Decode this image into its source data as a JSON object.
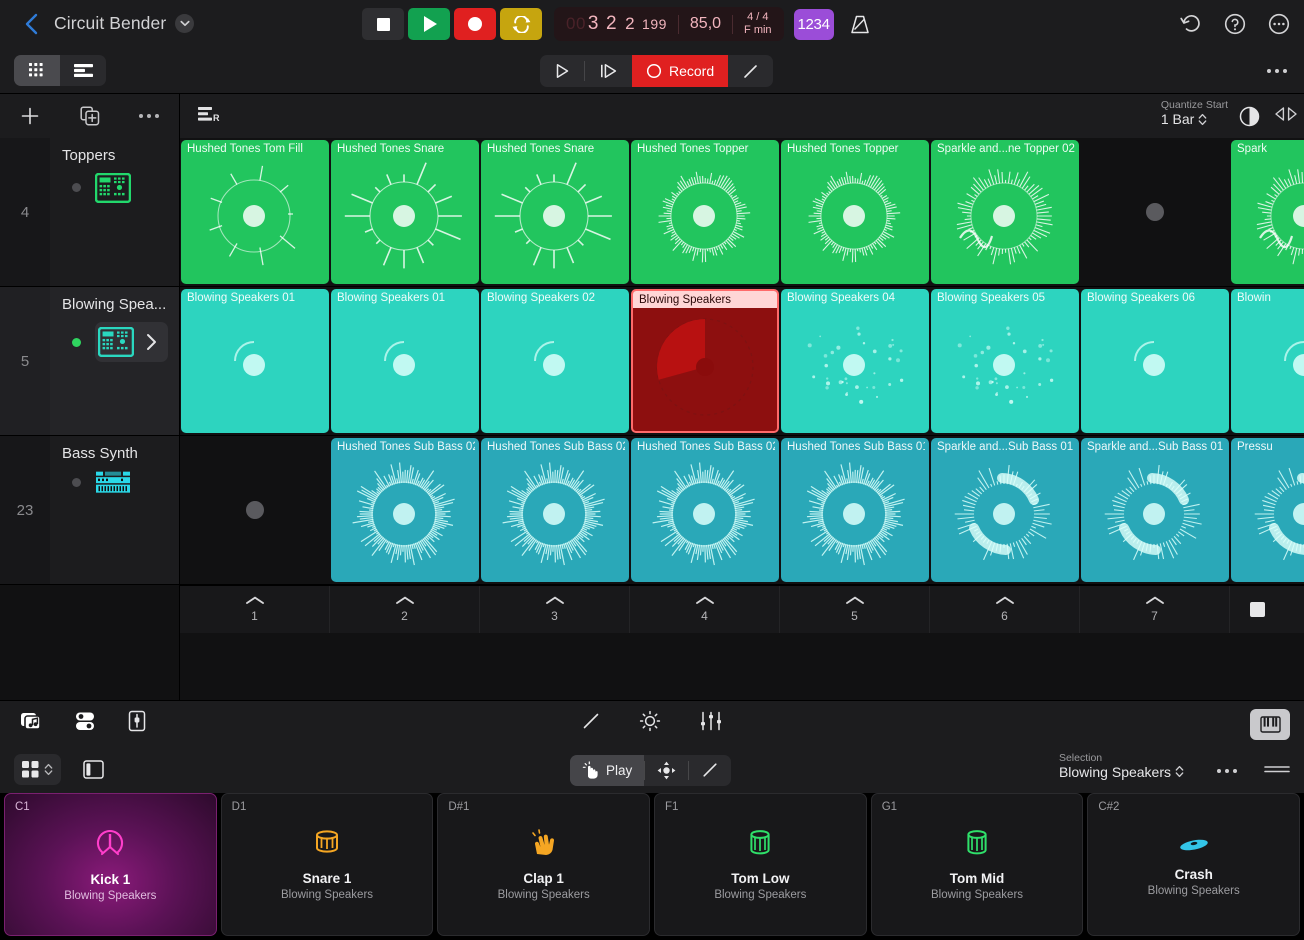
{
  "topbar": {
    "back_icon": "chevron-left-icon",
    "project_title": "Circuit Bender",
    "title_chevron_icon": "chevron-down-icon",
    "transport": {
      "stop_label": "stop",
      "play_label": "play",
      "record_label": "record",
      "cycle_label": "cycle"
    },
    "lcd": {
      "position_dim": "00",
      "bar": "3",
      "beat": "2",
      "division": "2",
      "ticks": "199",
      "tempo": "85,0",
      "time_signature": "4 / 4",
      "key": "F min"
    },
    "count_in_label": "1234",
    "metronome_icon": "metronome-icon",
    "undo_icon": "undo-icon",
    "help_icon": "help-icon",
    "more_icon": "more-icon"
  },
  "bar2": {
    "view_grid_icon": "grid-view-icon",
    "view_tracks_icon": "tracks-view-icon",
    "play_icon": "play-outline-icon",
    "play_from_icon": "play-from-start-icon",
    "record_label": "Record",
    "pencil_icon": "pencil-icon",
    "more_icon": "more-icon"
  },
  "track_toolbar": {
    "add_icon": "plus-icon",
    "duplicate_icon": "duplicate-icon",
    "more_icon": "more-icon",
    "mixer_icon": "mixer-r-icon",
    "quantize_label": "Quantize Start",
    "quantize_value": "1 Bar",
    "quantize_chevron_icon": "chevron-updown-icon",
    "pie_icon": "quantize-pie-icon",
    "arrows_icon": "play-stop-arrows-icon"
  },
  "tracks": [
    {
      "number": "4",
      "name": "Toppers",
      "instrument_icon": "drum-machine-icon",
      "icon_color": "#22d86c",
      "record_enabled": false,
      "selected": false,
      "has_chevron": false,
      "row_end": "play-stop-arrows-icon",
      "color": "#22c55e",
      "cells": [
        {
          "label": "Hushed Tones Tom Fill",
          "state": "clip",
          "art": "tomfill"
        },
        {
          "label": "Hushed Tones Snare",
          "state": "clip",
          "art": "snare"
        },
        {
          "label": "Hushed Tones Snare",
          "state": "clip",
          "art": "snare"
        },
        {
          "label": "Hushed Tones Topper",
          "state": "clip",
          "art": "topper"
        },
        {
          "label": "Hushed Tones Topper",
          "state": "clip",
          "art": "topper"
        },
        {
          "label": "Sparkle and...ne Topper 02",
          "state": "clip",
          "art": "sparkle"
        },
        {
          "label": "",
          "state": "empty",
          "art": ""
        },
        {
          "label": "Spark",
          "state": "clip-partial",
          "art": "sparkle"
        }
      ]
    },
    {
      "number": "5",
      "name": "Blowing Spea...",
      "instrument_icon": "drum-machine-icon",
      "icon_color": "#2ad8c0",
      "record_enabled": true,
      "selected": true,
      "has_chevron": true,
      "chevron_icon": "chevron-right-icon",
      "row_end": "stop-square",
      "color": "#2dd4bf",
      "cells": [
        {
          "label": "Blowing Speakers 01",
          "state": "clip",
          "art": "ring-small"
        },
        {
          "label": "Blowing Speakers 01",
          "state": "clip",
          "art": "ring-small"
        },
        {
          "label": "Blowing Speakers 02",
          "state": "clip",
          "art": "ring-small"
        },
        {
          "label": "Blowing Speakers",
          "state": "recording",
          "art": "recording-pie"
        },
        {
          "label": "Blowing Speakers 04",
          "state": "clip",
          "art": "sparse"
        },
        {
          "label": "Blowing Speakers 05",
          "state": "clip",
          "art": "sparse"
        },
        {
          "label": "Blowing Speakers 06",
          "state": "clip",
          "art": "ring-small"
        },
        {
          "label": "Blowin",
          "state": "clip-partial",
          "art": "ring-small"
        }
      ]
    },
    {
      "number": "23",
      "name": "Bass Synth",
      "instrument_icon": "synth-icon",
      "icon_color": "#2ad8e8",
      "record_enabled": false,
      "selected": false,
      "has_chevron": false,
      "row_end": "play-stop-arrows-icon",
      "color": "#2aa8b8",
      "cells": [
        {
          "label": "",
          "state": "empty",
          "art": ""
        },
        {
          "label": "Hushed Tones Sub Bass 02",
          "state": "clip",
          "art": "bass-ring"
        },
        {
          "label": "Hushed Tones Sub Bass 02",
          "state": "clip",
          "art": "bass-ring"
        },
        {
          "label": "Hushed Tones Sub Bass 02",
          "state": "clip",
          "art": "bass-ring"
        },
        {
          "label": "Hushed Tones Sub Bass 01",
          "state": "clip",
          "art": "bass-ring"
        },
        {
          "label": "Sparkle and...Sub Bass 01",
          "state": "clip",
          "art": "bass-swirl"
        },
        {
          "label": "Sparkle and...Sub Bass 01",
          "state": "clip",
          "art": "bass-swirl"
        },
        {
          "label": "Pressu",
          "state": "clip-partial",
          "art": "bass-swirl"
        }
      ]
    }
  ],
  "scenes": [
    {
      "num": "1"
    },
    {
      "num": "2"
    },
    {
      "num": "3"
    },
    {
      "num": "4"
    },
    {
      "num": "5"
    },
    {
      "num": "6"
    },
    {
      "num": "7"
    }
  ],
  "editor_bar": {
    "loops_icon": "loop-browser-icon",
    "toggles_icon": "sound-settings-icon",
    "plugin_icon": "plugin-icon",
    "pencil_icon": "pencil-icon",
    "brightness_icon": "brightness-icon",
    "faders_icon": "faders-icon",
    "keyboard_icon": "keyboard-icon"
  },
  "selection_bar": {
    "grid_icon": "pad-grid-icon",
    "grid_chevron_icon": "chevron-updown-icon",
    "panel_icon": "side-panel-icon",
    "play_label": "Play",
    "play_icon": "tap-hand-icon",
    "move_icon": "move-icon",
    "pencil_icon": "pencil-icon",
    "selection_label": "Selection",
    "selection_value": "Blowing Speakers",
    "selection_chevron_icon": "chevron-updown-icon",
    "more_icon": "more-icon",
    "handle_icon": "drag-handle-icon"
  },
  "pads": [
    {
      "note": "C1",
      "name": "Kick 1",
      "sub": "Blowing Speakers",
      "glyph": "kick",
      "color": "#ff3ecb",
      "active": true
    },
    {
      "note": "D1",
      "name": "Snare 1",
      "sub": "Blowing Speakers",
      "glyph": "snare",
      "color": "#f5a623",
      "active": false
    },
    {
      "note": "D#1",
      "name": "Clap 1",
      "sub": "Blowing Speakers",
      "glyph": "clap",
      "color": "#f5a623",
      "active": false
    },
    {
      "note": "F1",
      "name": "Tom Low",
      "sub": "Blowing Speakers",
      "glyph": "tom",
      "color": "#2fe06a",
      "active": false
    },
    {
      "note": "G1",
      "name": "Tom Mid",
      "sub": "Blowing Speakers",
      "glyph": "tom",
      "color": "#2fe06a",
      "active": false
    },
    {
      "note": "C#2",
      "name": "Crash",
      "sub": "Blowing Speakers",
      "glyph": "crash",
      "color": "#33c5e8",
      "active": false
    }
  ]
}
